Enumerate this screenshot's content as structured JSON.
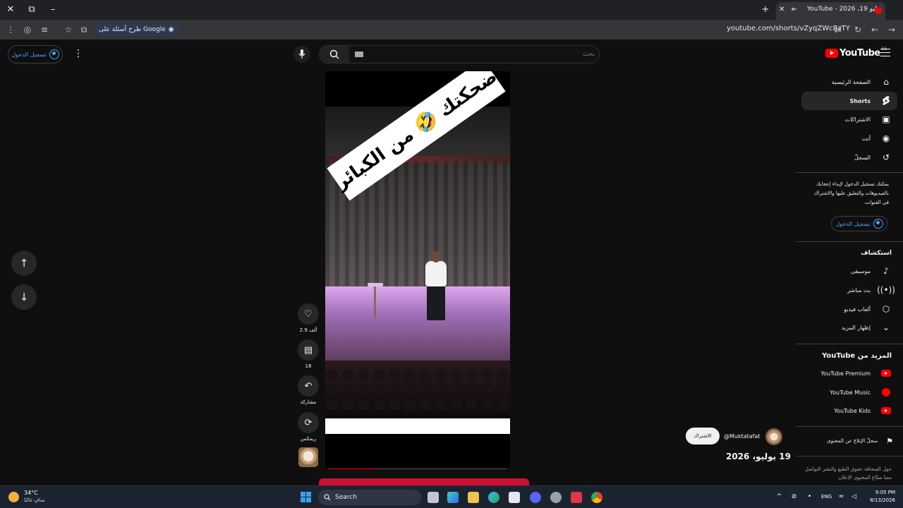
{
  "browser": {
    "tab_title": "YouTube - 2026 ،19 يوليو",
    "ask_google": "طرح أسئلة على Google",
    "url": "youtube.com/shorts/vZyqZWcBzTY"
  },
  "header": {
    "sign_in": "تسجيل الدخول",
    "search_placeholder": "بحث",
    "logo_text": "YouTube",
    "country_code": "ES"
  },
  "sidebar": {
    "primary": [
      {
        "label": "الصفحة الرئيسية",
        "icon": "home-icon"
      },
      {
        "label": "Shorts",
        "icon": "shorts-icon",
        "active": true
      },
      {
        "label": "الاشتراكات",
        "icon": "subscriptions-icon"
      },
      {
        "label": "أنت",
        "icon": "you-icon"
      },
      {
        "label": "السجلّ",
        "icon": "history-icon"
      }
    ],
    "signin_prompt": "يمكنك تسجيل الدخول لإبداء إعجابك بالفيديوهات والتعليق عليها والاشتراك في القنوات.",
    "signin_button": "تسجيل الدخول",
    "explore_title": "استكشاف",
    "explore": [
      {
        "label": "موسيقى",
        "icon": "music-icon"
      },
      {
        "label": "بث مباشر",
        "icon": "live-icon"
      },
      {
        "label": "ألعاب فيديو",
        "icon": "gaming-icon"
      },
      {
        "label": "إظهار المزيد",
        "icon": "chevron-down-icon"
      }
    ],
    "more_title": "المزيد من YouTube",
    "more": [
      {
        "label": "YouTube Premium"
      },
      {
        "label": "YouTube Music"
      },
      {
        "label": "YouTube Kids"
      }
    ],
    "report": "سجلّ الإبلاغ عن المحتوى",
    "footer": "حول الصحافة حقوق الطبع والنشر التواصل معنا صنّاع المحتوى الإعلان"
  },
  "video": {
    "overlay_text": "ضحكتك 🤣 من الكبائر",
    "progress": 0.27,
    "likes": "2.9 ألف",
    "comments": "18",
    "share": "مشاركة",
    "remix": "ريمكس",
    "channel": "@Muktatafat",
    "subscribe": "الاشتراك",
    "date": "19 يوليو، 2026"
  },
  "taskbar": {
    "temp": "34°C",
    "weather": "صافٍ غالبًا",
    "search": "Search",
    "lang": "ENG",
    "time": "9:05 PM",
    "date": "8/13/2026"
  },
  "colors": {
    "background": "#0f0f0f",
    "accent_blue": "#3ea6ff",
    "brand_red": "#ff0000"
  }
}
